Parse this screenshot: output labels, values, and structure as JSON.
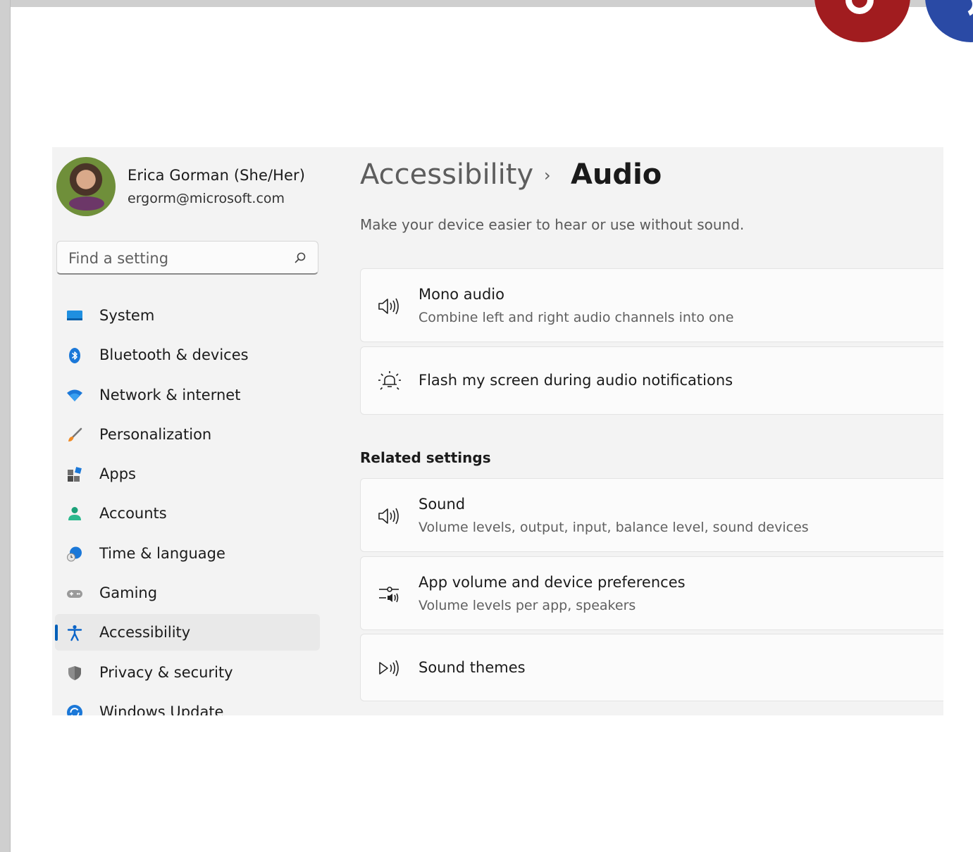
{
  "profile": {
    "name": "Erica Gorman (She/Her)",
    "email": "ergorm@microsoft.com"
  },
  "search": {
    "placeholder": "Find a setting"
  },
  "nav": {
    "items": [
      {
        "label": "System",
        "icon": "monitor-icon"
      },
      {
        "label": "Bluetooth & devices",
        "icon": "bluetooth-icon"
      },
      {
        "label": "Network & internet",
        "icon": "wifi-icon"
      },
      {
        "label": "Personalization",
        "icon": "brush-icon"
      },
      {
        "label": "Apps",
        "icon": "apps-icon"
      },
      {
        "label": "Accounts",
        "icon": "person-icon"
      },
      {
        "label": "Time & language",
        "icon": "globe-clock-icon"
      },
      {
        "label": "Gaming",
        "icon": "gamepad-icon"
      },
      {
        "label": "Accessibility",
        "icon": "accessibility-icon",
        "selected": true
      },
      {
        "label": "Privacy & security",
        "icon": "shield-icon"
      },
      {
        "label": "Windows Update",
        "icon": "update-icon"
      }
    ]
  },
  "header": {
    "breadcrumb_parent": "Accessibility",
    "breadcrumb_separator": "›",
    "breadcrumb_current": "Audio",
    "subtitle": "Make your device easier to hear or use without sound."
  },
  "cards": {
    "mono_audio": {
      "title": "Mono audio",
      "desc": "Combine left and right audio channels into one",
      "icon": "speaker-icon"
    },
    "flash_screen": {
      "title": "Flash my screen during audio notifications",
      "icon": "flash-bulb-icon"
    }
  },
  "related": {
    "heading": "Related settings",
    "sound": {
      "title": "Sound",
      "desc": "Volume levels, output, input, balance level, sound devices",
      "icon": "speaker-icon"
    },
    "app_volume": {
      "title": "App volume and device preferences",
      "desc": "Volume levels per app, speakers",
      "icon": "mixer-icon"
    },
    "sound_themes": {
      "title": "Sound themes",
      "icon": "sound-play-icon"
    }
  },
  "colors": {
    "accent": "#005fb8",
    "settings_bg": "#f3f3f3",
    "card_bg": "#fbfbfb",
    "badge_red": "#a11c1f",
    "badge_blue": "#2a4aa5"
  }
}
